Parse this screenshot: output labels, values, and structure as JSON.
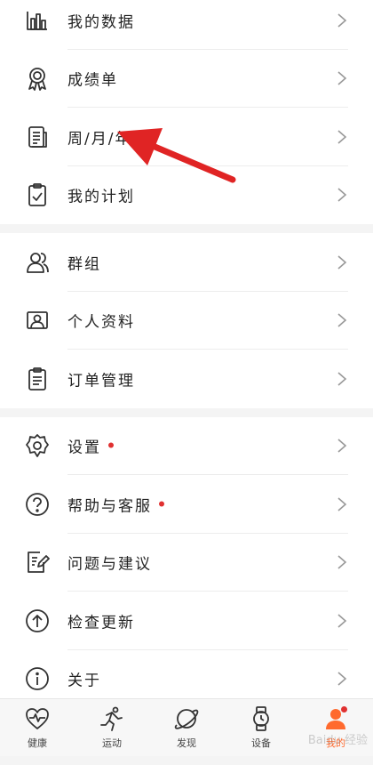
{
  "groups": [
    {
      "items": [
        {
          "label": "我的数据",
          "icon": "bar-chart-icon"
        },
        {
          "label": "成绩单",
          "icon": "medal-icon"
        },
        {
          "label": "周/月/年报",
          "icon": "report-list-icon"
        },
        {
          "label": "我的计划",
          "icon": "clipboard-check-icon"
        }
      ]
    },
    {
      "items": [
        {
          "label": "群组",
          "icon": "group-icon"
        },
        {
          "label": "个人资料",
          "icon": "profile-card-icon"
        },
        {
          "label": "订单管理",
          "icon": "order-clipboard-icon"
        }
      ]
    },
    {
      "items": [
        {
          "label": "设置",
          "icon": "gear-icon",
          "badge": true
        },
        {
          "label": "帮助与客服",
          "icon": "help-icon",
          "badge": true
        },
        {
          "label": "问题与建议",
          "icon": "feedback-edit-icon"
        },
        {
          "label": "检查更新",
          "icon": "upload-circle-icon"
        },
        {
          "label": "关于",
          "icon": "info-icon"
        }
      ]
    }
  ],
  "tabbar": {
    "tabs": [
      {
        "label": "健康",
        "icon": "heart-pulse-icon"
      },
      {
        "label": "运动",
        "icon": "running-icon"
      },
      {
        "label": "发现",
        "icon": "planet-icon"
      },
      {
        "label": "设备",
        "icon": "watch-icon"
      },
      {
        "label": "我的",
        "icon": "user-icon",
        "active": true,
        "badge": true
      }
    ]
  },
  "colors": {
    "accent": "#ff6a2e",
    "badge": "#e03131",
    "annotation_arrow": "#e02424"
  },
  "watermark": "Baidu 经验"
}
